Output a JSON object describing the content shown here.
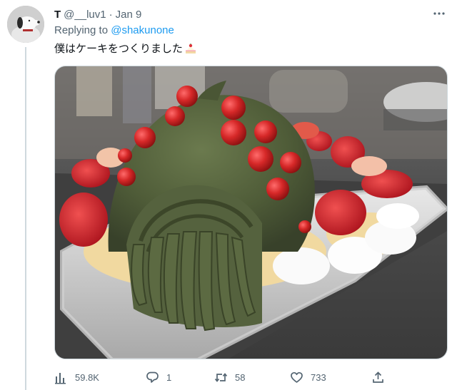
{
  "tweet": {
    "display_name": "T",
    "handle": "@__luv1",
    "separator": "·",
    "date": "Jan 9",
    "replying_to_prefix": "Replying to",
    "replying_to_handle": "@shakunone",
    "text": "僕はケーキをつくりました",
    "emoji_icon": "shortcake-icon"
  },
  "actions": {
    "views": "59.8K",
    "replies": "1",
    "retweets": "58",
    "likes": "733"
  },
  "colors": {
    "accent": "#1d9bf0",
    "secondary_text": "#536471",
    "primary_text": "#0f1419",
    "border": "#cfd9de"
  },
  "icons": {
    "views": "bar-chart-icon",
    "reply": "speech-bubble-icon",
    "retweet": "retweet-icon",
    "like": "heart-icon",
    "share": "share-upload-icon",
    "more": "more-dots-icon"
  }
}
